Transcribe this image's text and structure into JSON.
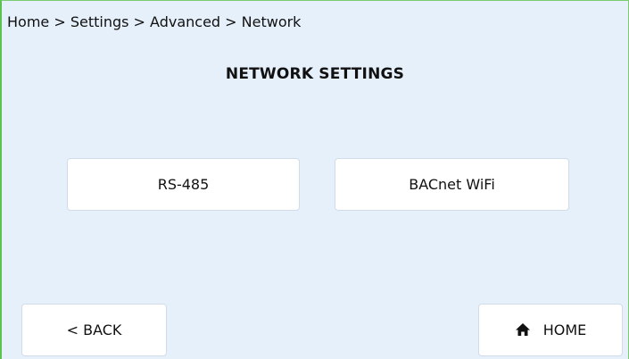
{
  "breadcrumb": "Home > Settings > Advanced > Network",
  "title": "NETWORK SETTINGS",
  "options": {
    "rs485_label": "RS-485",
    "bacnet_wifi_label": "BACnet WiFi"
  },
  "footer": {
    "back_label": "< BACK",
    "home_label": "HOME",
    "home_icon": "house-icon"
  },
  "colors": {
    "background": "#e6f0fb",
    "border_accent": "#5cc24f",
    "button_bg": "#ffffff"
  }
}
